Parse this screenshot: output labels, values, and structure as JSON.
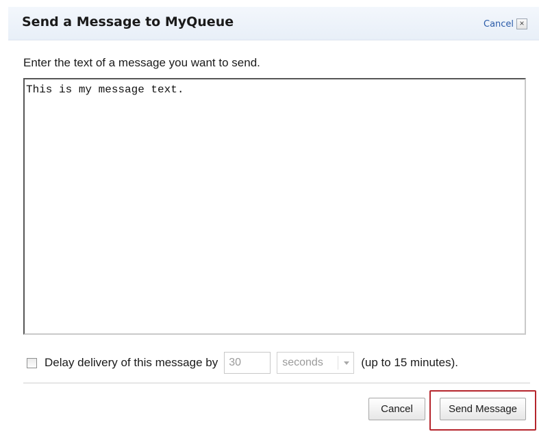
{
  "dialog": {
    "title": "Send a Message to MyQueue",
    "header_cancel_label": "Cancel",
    "close_glyph": "×"
  },
  "form": {
    "instruction": "Enter the text of a message you want to send.",
    "message_text": "This is my message text.",
    "delay_checked": false,
    "delay_label": "Delay delivery of this message by",
    "delay_value": "30",
    "delay_unit": "seconds",
    "delay_note": "(up to 15 minutes)."
  },
  "buttons": {
    "cancel_label": "Cancel",
    "send_label": "Send Message"
  },
  "colors": {
    "header_bg": "#e8eff8",
    "link": "#2a5ba8",
    "highlight": "#b5252c"
  }
}
